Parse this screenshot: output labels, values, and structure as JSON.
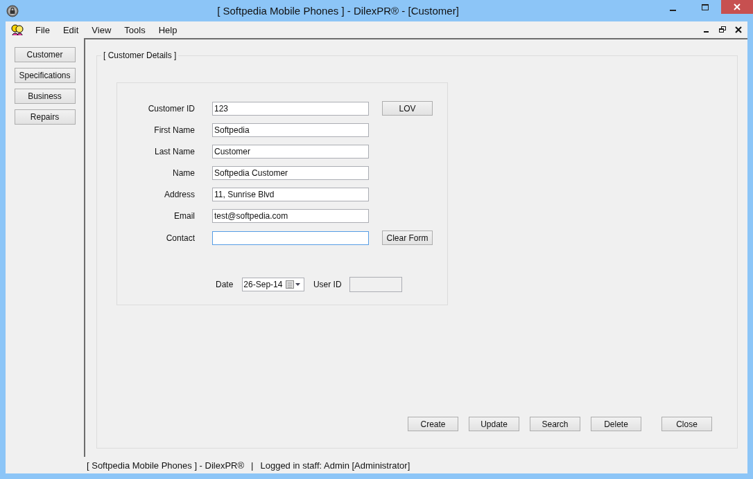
{
  "window": {
    "title": "[ Softpedia Mobile Phones ] - DilexPR® - [Customer]"
  },
  "menu": [
    "File",
    "Edit",
    "View",
    "Tools",
    "Help"
  ],
  "sidebar": {
    "items": [
      {
        "label": "Customer"
      },
      {
        "label": "Specifications"
      },
      {
        "label": "Business"
      },
      {
        "label": "Repairs"
      }
    ]
  },
  "group": {
    "title": "[ Customer Details ]"
  },
  "fields": [
    {
      "label": "Customer ID",
      "value": "123",
      "focused": false,
      "button": "LOV"
    },
    {
      "label": "First Name",
      "value": "Softpedia",
      "focused": false
    },
    {
      "label": "Last Name",
      "value": "Customer",
      "focused": false
    },
    {
      "label": "Name",
      "value": "Softpedia Customer",
      "focused": false
    },
    {
      "label": "Address",
      "value": "11, Sunrise Blvd",
      "focused": false
    },
    {
      "label": "Email",
      "value": "test@softpedia.com",
      "focused": false
    },
    {
      "label": "Contact",
      "focused": true,
      "button": "Clear Form"
    }
  ],
  "date": {
    "label": "Date",
    "value": "26-Sep-14"
  },
  "user_id": {
    "label": "User ID"
  },
  "actions": [
    "Create",
    "Update",
    "Search",
    "Delete",
    "Close"
  ],
  "status_bar": {
    "app": "[ Softpedia Mobile Phones ] - DilexPR®",
    "separator": "|",
    "user": "Logged in staff: Admin [Administrator]"
  }
}
